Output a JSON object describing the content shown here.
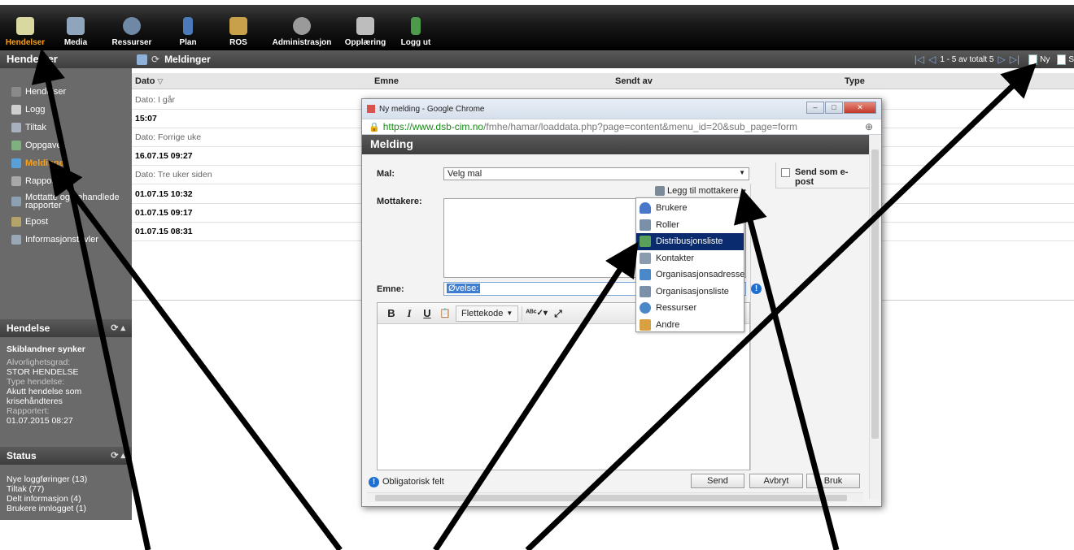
{
  "topbar": {
    "items": [
      {
        "label": "Hendelser",
        "icon": "events-icon",
        "color": "#d8d8a0"
      },
      {
        "label": "Media",
        "icon": "media-icon",
        "color": "#8fa4bd"
      },
      {
        "label": "Ressurser",
        "icon": "globe-icon",
        "color": "#6f88a6"
      },
      {
        "label": "Plan",
        "icon": "plan-book-icon",
        "color": "#4a7bb8"
      },
      {
        "label": "ROS",
        "icon": "ros-grid-icon",
        "color": "#c8a04a"
      },
      {
        "label": "Administrasjon",
        "icon": "gear-icon",
        "color": "#9a9a9a"
      },
      {
        "label": "Opplæring",
        "icon": "training-icon",
        "color": "#bdbdbd"
      },
      {
        "label": "Logg ut",
        "icon": "logout-door-icon",
        "color": "#4d9a4d"
      }
    ]
  },
  "left": {
    "title": "Hendelser",
    "items": [
      {
        "label": "Hendelser",
        "icon": "events-icon",
        "color": "#8a8a8a"
      },
      {
        "label": "Logg",
        "icon": "log-icon",
        "color": "#cfcfcf"
      },
      {
        "label": "Tiltak",
        "icon": "tiltak-icon",
        "color": "#a8b0bf"
      },
      {
        "label": "Oppgaver",
        "icon": "tasks-icon",
        "color": "#7fb07f"
      },
      {
        "label": "Meldinger",
        "icon": "messages-icon",
        "color": "#5aa0d8"
      },
      {
        "label": "Rapporter",
        "icon": "reports-icon",
        "color": "#a8a8a8"
      },
      {
        "label": "Mottatte og behandlede rapporter",
        "icon": "received-reports-icon",
        "color": "#8ea0b4"
      },
      {
        "label": "Epost",
        "icon": "email-icon",
        "color": "#b5a46a"
      },
      {
        "label": "Informasjonstavler",
        "icon": "info-board-icon",
        "color": "#9aa7b6"
      }
    ]
  },
  "hendelse": {
    "title": "Hendelse",
    "name": "Skiblandner synker",
    "severity_label": "Alvorlighetsgrad:",
    "severity": "STOR HENDELSE",
    "type_label": "Type hendelse:",
    "type": "Akutt hendelse som krisehåndteres",
    "reported_label": "Rapportert:",
    "reported": "01.07.2015 08:27"
  },
  "status": {
    "title": "Status",
    "lines": [
      "Nye loggføringer (13)",
      "Tiltak (77)",
      "Delt informasjon (4)",
      "Brukere innlogget (1)"
    ]
  },
  "grid": {
    "title": "Meldinger",
    "pager": "1 - 5 av totalt 5",
    "new_label": "Ny",
    "search_label": "S",
    "columns": [
      "Dato",
      "Emne",
      "Sendt av",
      "Type"
    ],
    "rows": [
      {
        "kind": "group",
        "text": "Dato: I går"
      },
      {
        "kind": "row",
        "text": "15:07"
      },
      {
        "kind": "group",
        "text": "Dato: Forrige uke"
      },
      {
        "kind": "row",
        "text": "16.07.15 09:27"
      },
      {
        "kind": "group",
        "text": "Dato: Tre uker siden"
      },
      {
        "kind": "row",
        "text": "01.07.15 10:32"
      },
      {
        "kind": "row",
        "text": "01.07.15 09:17"
      },
      {
        "kind": "row",
        "text": "01.07.15 08:31"
      }
    ]
  },
  "popup": {
    "window_title": "Ny melding - Google Chrome",
    "url_host": "https://www.dsb-cim.no",
    "url_path": "/fmhe/hamar/loaddata.php?page=content&menu_id=20&sub_page=form",
    "header": "Melding",
    "mal_label": "Mal:",
    "mal_value": "Velg mal",
    "send_epost": "Send som e-post",
    "mottakere_label": "Mottakere:",
    "legg_til": "Legg til mottakere",
    "emne_label": "Emne:",
    "emne_value": "Øvelse:",
    "toolbar": {
      "bold": "B",
      "italic": "I",
      "underline": "U",
      "flettekode": "Flettekode"
    },
    "footer_note": "Obligatorisk felt",
    "buttons": {
      "send": "Send",
      "cancel": "Avbryt",
      "use": "Bruk"
    }
  },
  "menu": {
    "items": [
      {
        "label": "Brukere",
        "icon": "user-icon",
        "color": "#4a78c8"
      },
      {
        "label": "Roller",
        "icon": "roles-icon",
        "color": "#7a8fa8"
      },
      {
        "label": "Distribusjonsliste",
        "icon": "distribution-list-icon",
        "color": "#5aa05a"
      },
      {
        "label": "Kontakter",
        "icon": "contacts-icon",
        "color": "#8a9bb0"
      },
      {
        "label": "Organisasjonsadresse",
        "icon": "org-address-icon",
        "color": "#4a88c8"
      },
      {
        "label": "Organisasjonsliste",
        "icon": "org-list-icon",
        "color": "#7a8fa8"
      },
      {
        "label": "Ressurser",
        "icon": "resources-icon",
        "color": "#4a88c8"
      },
      {
        "label": "Andre",
        "icon": "others-icon",
        "color": "#d8a040"
      }
    ],
    "selected": 2
  },
  "colors": {
    "accent": "#f5a01e",
    "menu_selected": "#0a2c6e"
  }
}
